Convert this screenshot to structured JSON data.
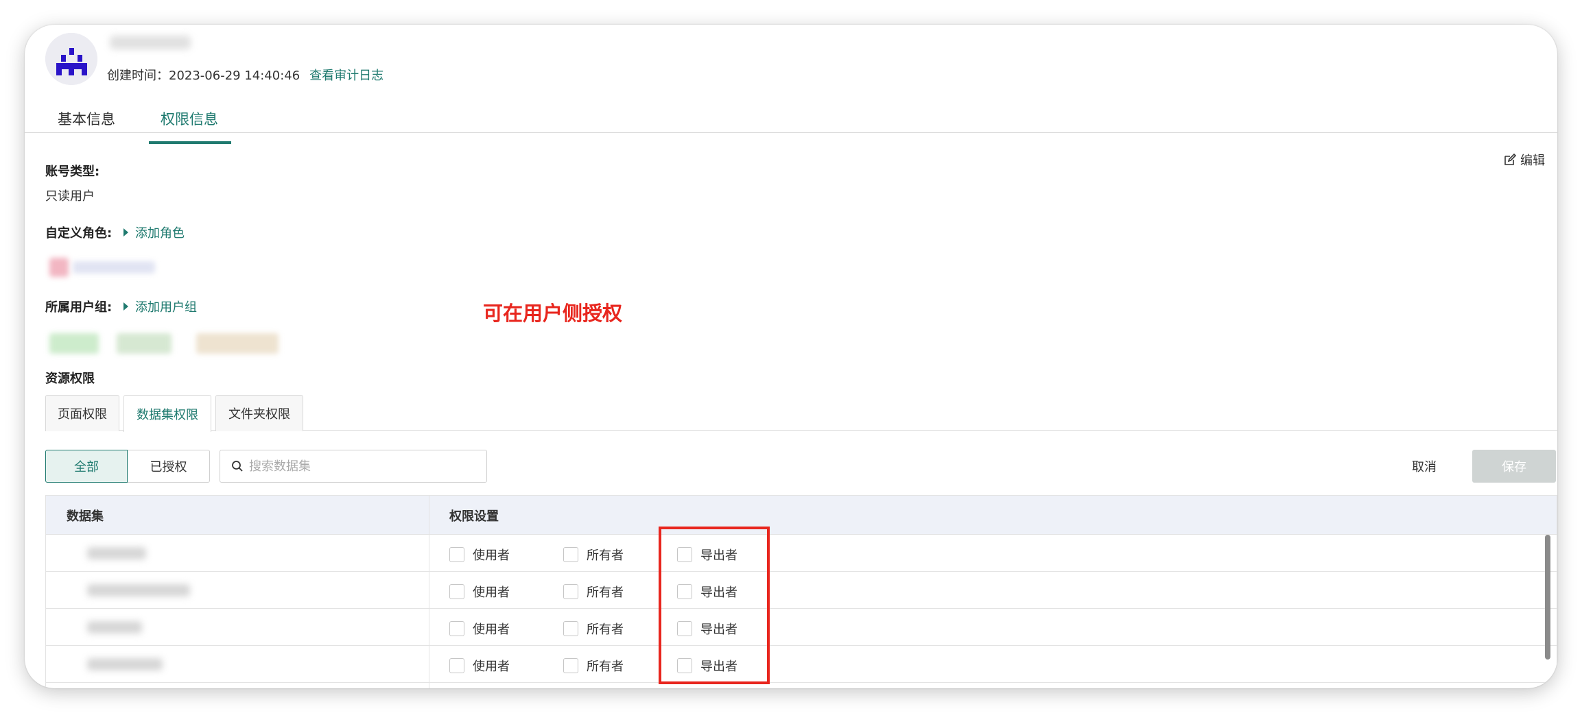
{
  "header": {
    "created_label": "创建时间：",
    "created_value": "2023-06-29 14:40:46",
    "audit_link": "查看审计日志"
  },
  "main_tabs": [
    {
      "label": "基本信息"
    },
    {
      "label": "权限信息"
    }
  ],
  "edit_label": "编辑",
  "account_type": {
    "label": "账号类型:",
    "value": "只读用户"
  },
  "custom_role": {
    "label": "自定义角色:",
    "add_label": "添加角色"
  },
  "user_group": {
    "label": "所属用户组:",
    "add_label": "添加用户组"
  },
  "annotation": "可在用户侧授权",
  "resource": {
    "title": "资源权限",
    "tabs": [
      {
        "label": "页面权限"
      },
      {
        "label": "数据集权限"
      },
      {
        "label": "文件夹权限"
      }
    ]
  },
  "filter": {
    "all_label": "全部",
    "authorized_label": "已授权",
    "search_placeholder": "搜索数据集"
  },
  "actions": {
    "cancel": "取消",
    "save": "保存"
  },
  "table": {
    "headers": [
      "数据集",
      "权限设置"
    ],
    "permission_options": [
      "使用者",
      "所有者",
      "导出者"
    ]
  },
  "colors": {
    "accent": "#1f7a6f",
    "annotation": "#e8261e"
  }
}
